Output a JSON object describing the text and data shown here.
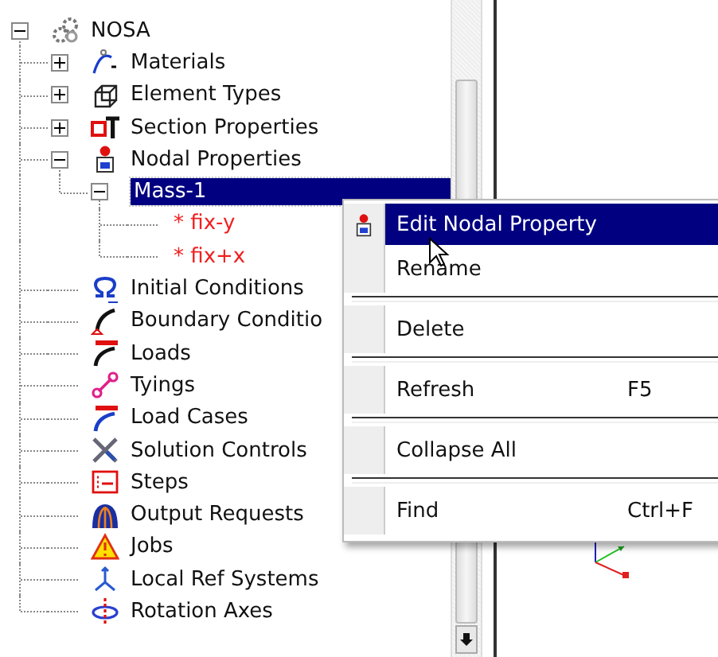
{
  "tree": {
    "label": "NOSA",
    "kind": "root",
    "expanded": true,
    "selected": false,
    "children": [
      {
        "label": "Materials",
        "kind": "materials",
        "expanded": false,
        "selected": false
      },
      {
        "label": "Element Types",
        "kind": "element-types",
        "expanded": false,
        "selected": false
      },
      {
        "label": "Section Properties",
        "kind": "section",
        "expanded": false,
        "selected": false
      },
      {
        "label": "Nodal Properties",
        "kind": "nodal",
        "expanded": true,
        "selected": false,
        "children": [
          {
            "label": "Mass-1",
            "expanded": true,
            "selected": true,
            "children": [
              {
                "label": "fix-y",
                "marker": "*",
                "kind": "constraint"
              },
              {
                "label": "fix+x",
                "marker": "*",
                "kind": "constraint"
              }
            ]
          }
        ]
      },
      {
        "label": "Initial Conditions",
        "kind": "initial",
        "selected": false
      },
      {
        "label": "Boundary Conditio",
        "kind": "boundary",
        "selected": false
      },
      {
        "label": "Loads",
        "kind": "loads",
        "selected": false
      },
      {
        "label": "Tyings",
        "kind": "tyings",
        "selected": false
      },
      {
        "label": "Load Cases",
        "kind": "load-cases",
        "selected": false
      },
      {
        "label": "Solution Controls",
        "kind": "solution",
        "selected": false
      },
      {
        "label": "Steps",
        "kind": "steps",
        "selected": false
      },
      {
        "label": "Output Requests",
        "kind": "output",
        "selected": false
      },
      {
        "label": "Jobs",
        "kind": "jobs",
        "selected": false
      },
      {
        "label": "Local Ref Systems",
        "kind": "local-ref",
        "selected": false
      },
      {
        "label": "Rotation Axes",
        "kind": "rotation",
        "selected": false
      }
    ]
  },
  "context_menu": {
    "items": [
      {
        "label": "Edit Nodal Property",
        "kind": "nodal",
        "selected": true,
        "separator_before": false
      },
      {
        "label": "Rename",
        "selected": false,
        "separator_before": false
      },
      {
        "label": "Delete",
        "selected": false,
        "separator_before": true
      },
      {
        "label": "Refresh",
        "shortcut": "F5",
        "selected": false,
        "separator_before": true
      },
      {
        "label": "Collapse All",
        "selected": false,
        "separator_before": true
      },
      {
        "label": "Find",
        "shortcut": "Ctrl+F",
        "selected": false,
        "separator_before": true
      }
    ]
  }
}
